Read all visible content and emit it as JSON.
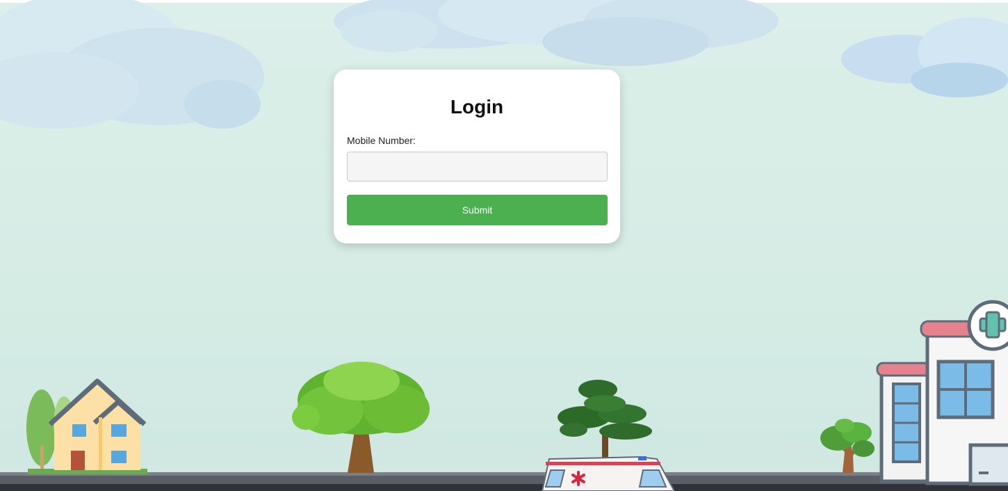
{
  "login": {
    "title": "Login",
    "mobile_label": "Mobile Number:",
    "mobile_value": "",
    "submit_label": "Submit"
  },
  "colors": {
    "submit_bg": "#4caf50",
    "card_bg": "#ffffff"
  },
  "icons": {
    "ambulance_cross": "red-asterisk-icon",
    "hospital_cross": "medical-cross-icon"
  }
}
